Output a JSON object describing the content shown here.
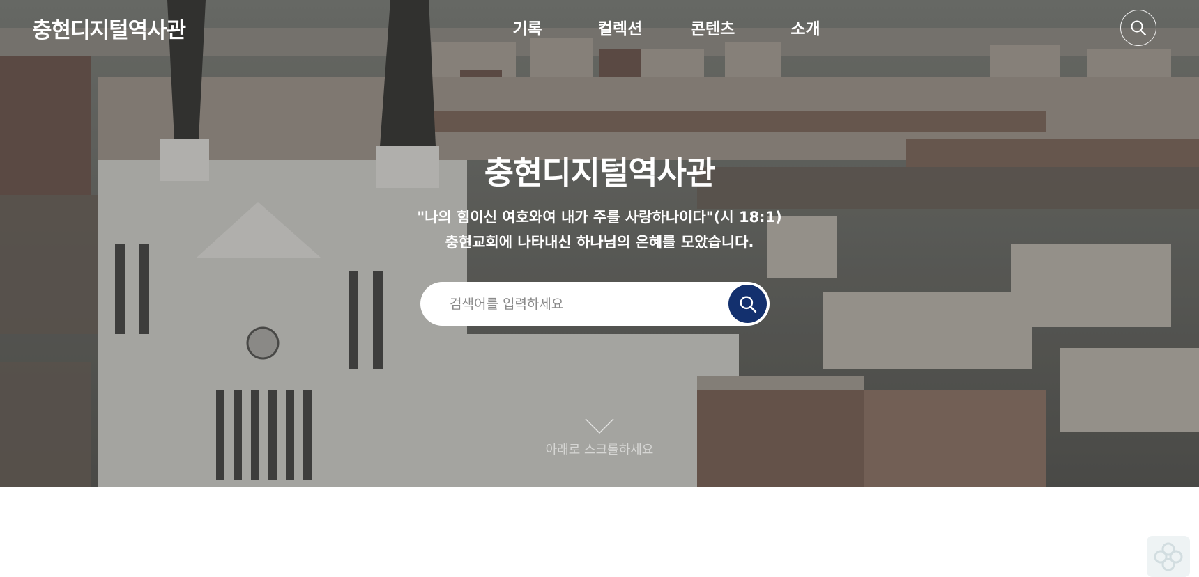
{
  "header": {
    "logo": "충현디지털역사관",
    "nav": [
      {
        "label": "기록"
      },
      {
        "label": "컬렉션"
      },
      {
        "label": "콘텐츠"
      },
      {
        "label": "소개"
      }
    ],
    "search_icon": "search-icon"
  },
  "hero": {
    "title": "충현디지털역사관",
    "subtitle_line1": "\"나의 힘이신 여호와여 내가 주를 사랑하나이다\"(시 18:1)",
    "subtitle_line2": "충현교회에 나타내신 하나님의 은혜를 모았습니다.",
    "search": {
      "placeholder": "검색어를 입력하세요",
      "value": "",
      "button_icon": "search-icon"
    },
    "scroll_hint": "아래로 스크롤하세요",
    "scroll_icon": "chevron-down-icon"
  },
  "corner_widget": {
    "icon": "flower-logo-icon"
  },
  "colors": {
    "search_button": "#13306e",
    "text_on_hero": "#ffffff",
    "page_background": "#ffffff"
  }
}
